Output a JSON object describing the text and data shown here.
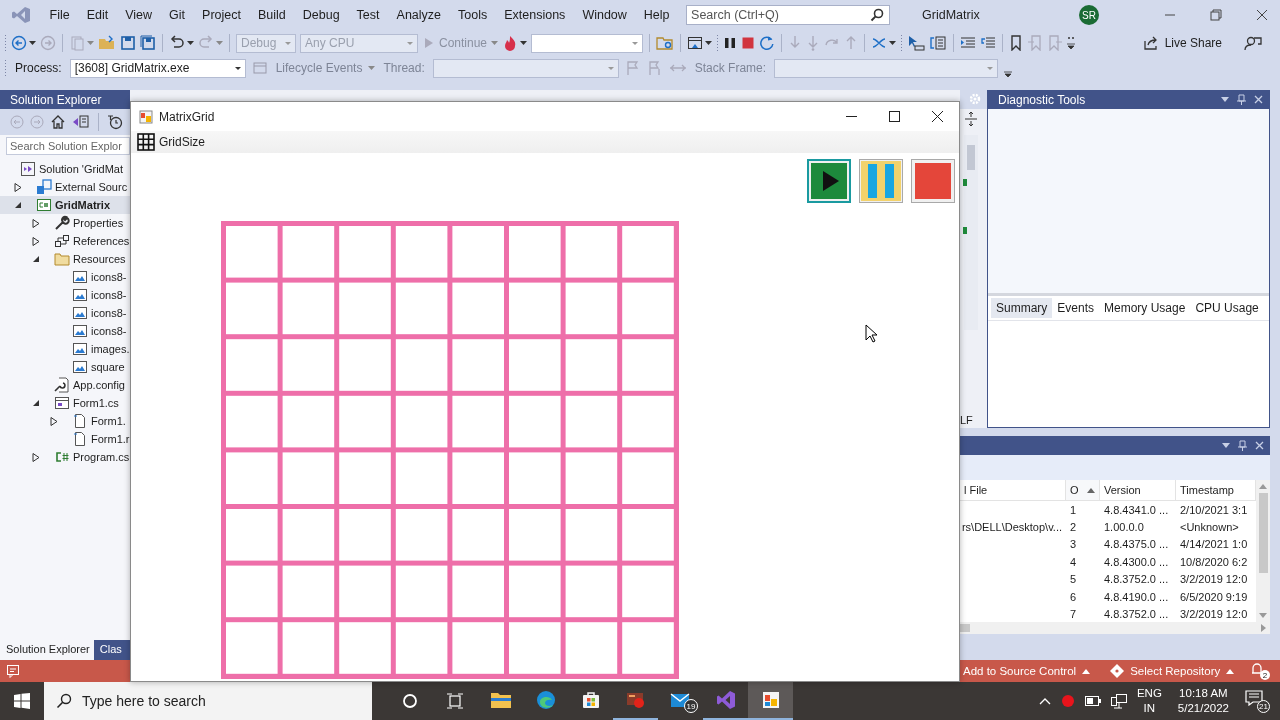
{
  "ide": {
    "menu": [
      "File",
      "Edit",
      "View",
      "Git",
      "Project",
      "Build",
      "Debug",
      "Test",
      "Analyze",
      "Tools",
      "Extensions",
      "Window",
      "Help"
    ],
    "search": {
      "placeholder": "Search (Ctrl+Q)"
    },
    "title": "GridMatrix",
    "avatar": "SR",
    "toolbar": {
      "configuration": "Debug",
      "platform": "Any CPU",
      "continue": "Continue",
      "live_share": "Live Share"
    },
    "debug_toolbar": {
      "process_label": "Process:",
      "process": "[3608] GridMatrix.exe",
      "lifecycle": "Lifecycle Events",
      "thread_label": "Thread:",
      "stack_frame_label": "Stack Frame:"
    }
  },
  "solution_explorer": {
    "title": "Solution Explorer",
    "search": {
      "placeholder": "Search Solution Explor"
    },
    "tree": [
      {
        "label": "Solution 'GridMat",
        "kind": "solution",
        "selected": false,
        "children": [
          {
            "label": "External Sourc",
            "kind": "external",
            "expanded": false,
            "selected": false
          },
          {
            "label": "GridMatrix",
            "kind": "project",
            "expanded": true,
            "selected": true,
            "children": [
              {
                "label": "Properties",
                "kind": "wrench",
                "expanded": false,
                "selected": false
              },
              {
                "label": "References",
                "kind": "references",
                "expanded": false,
                "selected": false
              },
              {
                "label": "Resources",
                "kind": "folder",
                "expanded": true,
                "selected": false,
                "children": [
                  {
                    "label": "icons8-",
                    "kind": "image",
                    "selected": false
                  },
                  {
                    "label": "icons8-",
                    "kind": "image",
                    "selected": false
                  },
                  {
                    "label": "icons8-",
                    "kind": "image",
                    "selected": false
                  },
                  {
                    "label": "icons8-",
                    "kind": "image",
                    "selected": false
                  },
                  {
                    "label": "images.",
                    "kind": "image",
                    "selected": false
                  },
                  {
                    "label": "square",
                    "kind": "image",
                    "selected": false
                  }
                ]
              },
              {
                "label": "App.config",
                "kind": "config",
                "selected": false
              },
              {
                "label": "Form1.cs",
                "kind": "form",
                "expanded": true,
                "selected": false,
                "children": [
                  {
                    "label": "Form1.",
                    "kind": "file",
                    "expanded": false,
                    "selected": false
                  },
                  {
                    "label": "Form1.r",
                    "kind": "file",
                    "selected": false
                  }
                ]
              },
              {
                "label": "Program.cs",
                "kind": "csharp",
                "expanded": false,
                "selected": false
              }
            ]
          }
        ]
      }
    ],
    "tabs": [
      {
        "label": "Solution Explorer",
        "selected": true
      },
      {
        "label": "Clas",
        "selected": false
      }
    ]
  },
  "diagnostic_tools": {
    "title": "Diagnostic Tools",
    "tabs": [
      {
        "label": "Summary",
        "selected": true
      },
      {
        "label": "Events",
        "selected": false
      },
      {
        "label": "Memory Usage",
        "selected": false
      },
      {
        "label": "CPU Usage",
        "selected": false
      }
    ]
  },
  "editor_margin": {
    "line_ending": "LF"
  },
  "modules": {
    "columns": [
      {
        "label": "l File",
        "sorted": false
      },
      {
        "label": "O",
        "sorted": true
      },
      {
        "label": "Version",
        "sorted": false
      },
      {
        "label": "Timestamp",
        "sorted": false
      }
    ],
    "rows": [
      {
        "column_2": "1",
        "version": "4.8.4341.0 ...",
        "timestamp": "2/10/2021 3:1"
      },
      {
        "column_1": "rs\\DELL\\Desktop\\v...",
        "column_2": "2",
        "version": "1.00.0.0",
        "timestamp": "<Unknown>"
      },
      {
        "column_2": "3",
        "version": "4.8.4375.0 ...",
        "timestamp": "4/14/2021 1:0"
      },
      {
        "column_2": "4",
        "version": "4.8.4300.0 ...",
        "timestamp": "10/8/2020 6:2"
      },
      {
        "column_2": "5",
        "version": "4.8.3752.0 ...",
        "timestamp": "3/2/2019 12:0"
      },
      {
        "column_2": "6",
        "version": "4.8.4190.0 ...",
        "timestamp": "6/5/2020 9:19"
      },
      {
        "column_2": "7",
        "version": "4.8.3752.0 ...",
        "timestamp": "3/2/2019 12:0"
      }
    ]
  },
  "form": {
    "title": "MatrixGrid",
    "menu": "GridSize",
    "buttons": [
      {
        "kind": "play",
        "focused": true
      },
      {
        "kind": "pause",
        "focused": false
      },
      {
        "kind": "stop",
        "focused": false
      }
    ]
  },
  "status_bar": {
    "source_control": "Add to Source Control",
    "repository": "Select Repository",
    "notifications": "2"
  },
  "taskbar": {
    "search": {
      "placeholder": "Type here to search"
    },
    "apps": [
      {
        "kind": "folder",
        "running": false,
        "active": false
      },
      {
        "kind": "browser",
        "running": false,
        "active": false
      },
      {
        "kind": "store",
        "running": false,
        "active": false
      },
      {
        "kind": "paint",
        "running": true,
        "active": false
      },
      {
        "kind": "mail",
        "badge": "19",
        "running": false,
        "active": false
      },
      {
        "kind": "studio",
        "running": true,
        "active": false
      },
      {
        "kind": "window",
        "running": true,
        "active": true
      }
    ],
    "language": "ENG",
    "region": "IN",
    "time": "10:18 AM",
    "date": "5/21/2022",
    "notifications": "21"
  }
}
